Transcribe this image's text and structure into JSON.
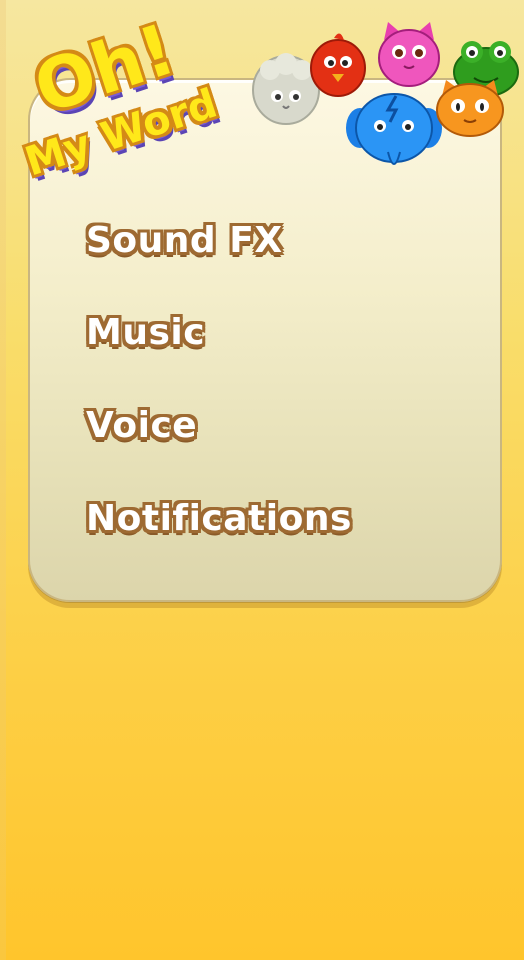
{
  "logo": {
    "line1": "Oh!",
    "line2": "My Word"
  },
  "menu": {
    "items": [
      {
        "label": "Sound FX"
      },
      {
        "label": "Music"
      },
      {
        "label": "Voice"
      },
      {
        "label": "Notifications"
      }
    ]
  },
  "critters": [
    "sheep-icon",
    "red-bird-icon",
    "pink-cat-icon",
    "green-frog-icon",
    "blue-elephant-icon",
    "orange-cat-icon"
  ],
  "colors": {
    "background": "#fdcf45",
    "panel": "#f4eecb",
    "label_fill": "#ffffff",
    "label_outline": "#9e6a32",
    "logo_fill": "#ffe81a",
    "logo_shadow": "#5b45b5"
  }
}
